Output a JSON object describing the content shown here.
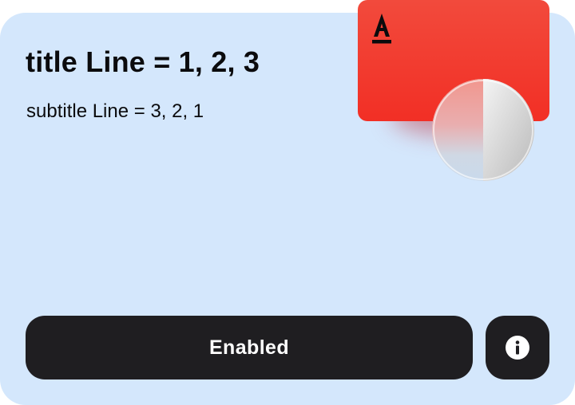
{
  "card": {
    "title": "title Line = 1, 2, 3",
    "subtitle": "subtitle Line = 3, 2, 1"
  },
  "actions": {
    "primary_label": "Enabled",
    "info_icon": "info-icon"
  },
  "illustration": {
    "bank_card_icon": "bank-card",
    "bank_logo_icon": "alfa-logo-icon",
    "coin_icon": "coin",
    "colors": {
      "card_background": "#d4e7fc",
      "bank_card_red": "#f23a2f",
      "button_dark": "#1f1e21"
    }
  }
}
